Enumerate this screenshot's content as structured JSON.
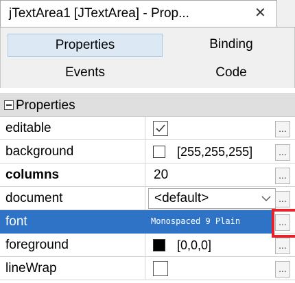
{
  "window": {
    "title": "jTextArea1 [JTextArea] - Prop...",
    "close_glyph": "✕"
  },
  "tabs": [
    {
      "label": "Properties",
      "active": true
    },
    {
      "label": "Binding",
      "active": false
    },
    {
      "label": "Events",
      "active": false
    },
    {
      "label": "Code",
      "active": false
    }
  ],
  "section": {
    "label": "Properties",
    "icon": "collapse-minus-icon"
  },
  "rows": [
    {
      "name": "editable",
      "type": "checkbox",
      "checked": true
    },
    {
      "name": "background",
      "type": "color",
      "color": "#ffffff",
      "value": "[255,255,255]"
    },
    {
      "name": "columns",
      "type": "text",
      "value": "20",
      "bold": true
    },
    {
      "name": "document",
      "type": "combo",
      "value": "<default>"
    },
    {
      "name": "font",
      "type": "font",
      "value": "Monospaced 9 Plain",
      "selected": true
    },
    {
      "name": "foreground",
      "type": "color",
      "color": "#000000",
      "value": "[0,0,0]"
    },
    {
      "name": "lineWrap",
      "type": "checkbox",
      "checked": false
    }
  ],
  "ellipsis": "...",
  "colors": {
    "selection": "#2f73c7",
    "active_tab": "#dce9f5",
    "highlight": "#e5222b"
  }
}
